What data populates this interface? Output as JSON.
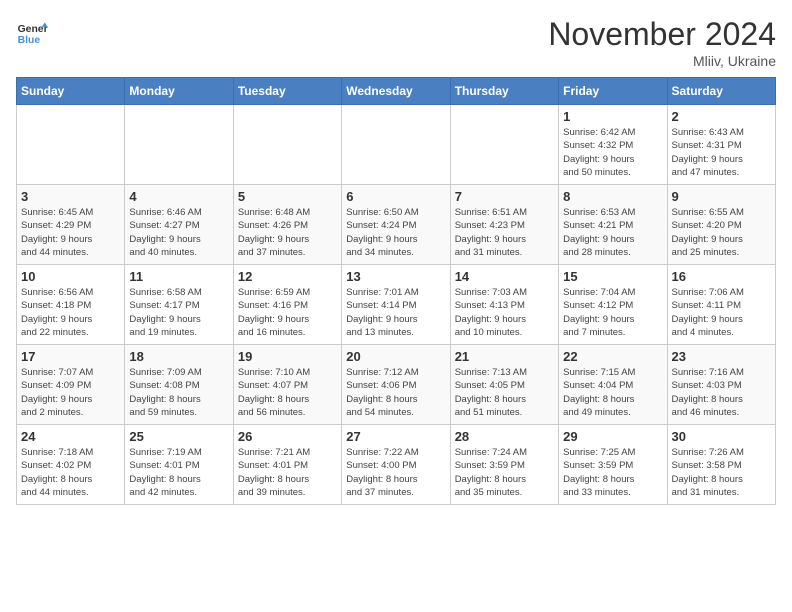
{
  "logo": {
    "line1": "General",
    "line2": "Blue"
  },
  "title": "November 2024",
  "location": "Mliiv, Ukraine",
  "days_of_week": [
    "Sunday",
    "Monday",
    "Tuesday",
    "Wednesday",
    "Thursday",
    "Friday",
    "Saturday"
  ],
  "weeks": [
    [
      {
        "day": "",
        "info": ""
      },
      {
        "day": "",
        "info": ""
      },
      {
        "day": "",
        "info": ""
      },
      {
        "day": "",
        "info": ""
      },
      {
        "day": "",
        "info": ""
      },
      {
        "day": "1",
        "info": "Sunrise: 6:42 AM\nSunset: 4:32 PM\nDaylight: 9 hours\nand 50 minutes."
      },
      {
        "day": "2",
        "info": "Sunrise: 6:43 AM\nSunset: 4:31 PM\nDaylight: 9 hours\nand 47 minutes."
      }
    ],
    [
      {
        "day": "3",
        "info": "Sunrise: 6:45 AM\nSunset: 4:29 PM\nDaylight: 9 hours\nand 44 minutes."
      },
      {
        "day": "4",
        "info": "Sunrise: 6:46 AM\nSunset: 4:27 PM\nDaylight: 9 hours\nand 40 minutes."
      },
      {
        "day": "5",
        "info": "Sunrise: 6:48 AM\nSunset: 4:26 PM\nDaylight: 9 hours\nand 37 minutes."
      },
      {
        "day": "6",
        "info": "Sunrise: 6:50 AM\nSunset: 4:24 PM\nDaylight: 9 hours\nand 34 minutes."
      },
      {
        "day": "7",
        "info": "Sunrise: 6:51 AM\nSunset: 4:23 PM\nDaylight: 9 hours\nand 31 minutes."
      },
      {
        "day": "8",
        "info": "Sunrise: 6:53 AM\nSunset: 4:21 PM\nDaylight: 9 hours\nand 28 minutes."
      },
      {
        "day": "9",
        "info": "Sunrise: 6:55 AM\nSunset: 4:20 PM\nDaylight: 9 hours\nand 25 minutes."
      }
    ],
    [
      {
        "day": "10",
        "info": "Sunrise: 6:56 AM\nSunset: 4:18 PM\nDaylight: 9 hours\nand 22 minutes."
      },
      {
        "day": "11",
        "info": "Sunrise: 6:58 AM\nSunset: 4:17 PM\nDaylight: 9 hours\nand 19 minutes."
      },
      {
        "day": "12",
        "info": "Sunrise: 6:59 AM\nSunset: 4:16 PM\nDaylight: 9 hours\nand 16 minutes."
      },
      {
        "day": "13",
        "info": "Sunrise: 7:01 AM\nSunset: 4:14 PM\nDaylight: 9 hours\nand 13 minutes."
      },
      {
        "day": "14",
        "info": "Sunrise: 7:03 AM\nSunset: 4:13 PM\nDaylight: 9 hours\nand 10 minutes."
      },
      {
        "day": "15",
        "info": "Sunrise: 7:04 AM\nSunset: 4:12 PM\nDaylight: 9 hours\nand 7 minutes."
      },
      {
        "day": "16",
        "info": "Sunrise: 7:06 AM\nSunset: 4:11 PM\nDaylight: 9 hours\nand 4 minutes."
      }
    ],
    [
      {
        "day": "17",
        "info": "Sunrise: 7:07 AM\nSunset: 4:09 PM\nDaylight: 9 hours\nand 2 minutes."
      },
      {
        "day": "18",
        "info": "Sunrise: 7:09 AM\nSunset: 4:08 PM\nDaylight: 8 hours\nand 59 minutes."
      },
      {
        "day": "19",
        "info": "Sunrise: 7:10 AM\nSunset: 4:07 PM\nDaylight: 8 hours\nand 56 minutes."
      },
      {
        "day": "20",
        "info": "Sunrise: 7:12 AM\nSunset: 4:06 PM\nDaylight: 8 hours\nand 54 minutes."
      },
      {
        "day": "21",
        "info": "Sunrise: 7:13 AM\nSunset: 4:05 PM\nDaylight: 8 hours\nand 51 minutes."
      },
      {
        "day": "22",
        "info": "Sunrise: 7:15 AM\nSunset: 4:04 PM\nDaylight: 8 hours\nand 49 minutes."
      },
      {
        "day": "23",
        "info": "Sunrise: 7:16 AM\nSunset: 4:03 PM\nDaylight: 8 hours\nand 46 minutes."
      }
    ],
    [
      {
        "day": "24",
        "info": "Sunrise: 7:18 AM\nSunset: 4:02 PM\nDaylight: 8 hours\nand 44 minutes."
      },
      {
        "day": "25",
        "info": "Sunrise: 7:19 AM\nSunset: 4:01 PM\nDaylight: 8 hours\nand 42 minutes."
      },
      {
        "day": "26",
        "info": "Sunrise: 7:21 AM\nSunset: 4:01 PM\nDaylight: 8 hours\nand 39 minutes."
      },
      {
        "day": "27",
        "info": "Sunrise: 7:22 AM\nSunset: 4:00 PM\nDaylight: 8 hours\nand 37 minutes."
      },
      {
        "day": "28",
        "info": "Sunrise: 7:24 AM\nSunset: 3:59 PM\nDaylight: 8 hours\nand 35 minutes."
      },
      {
        "day": "29",
        "info": "Sunrise: 7:25 AM\nSunset: 3:59 PM\nDaylight: 8 hours\nand 33 minutes."
      },
      {
        "day": "30",
        "info": "Sunrise: 7:26 AM\nSunset: 3:58 PM\nDaylight: 8 hours\nand 31 minutes."
      }
    ]
  ]
}
